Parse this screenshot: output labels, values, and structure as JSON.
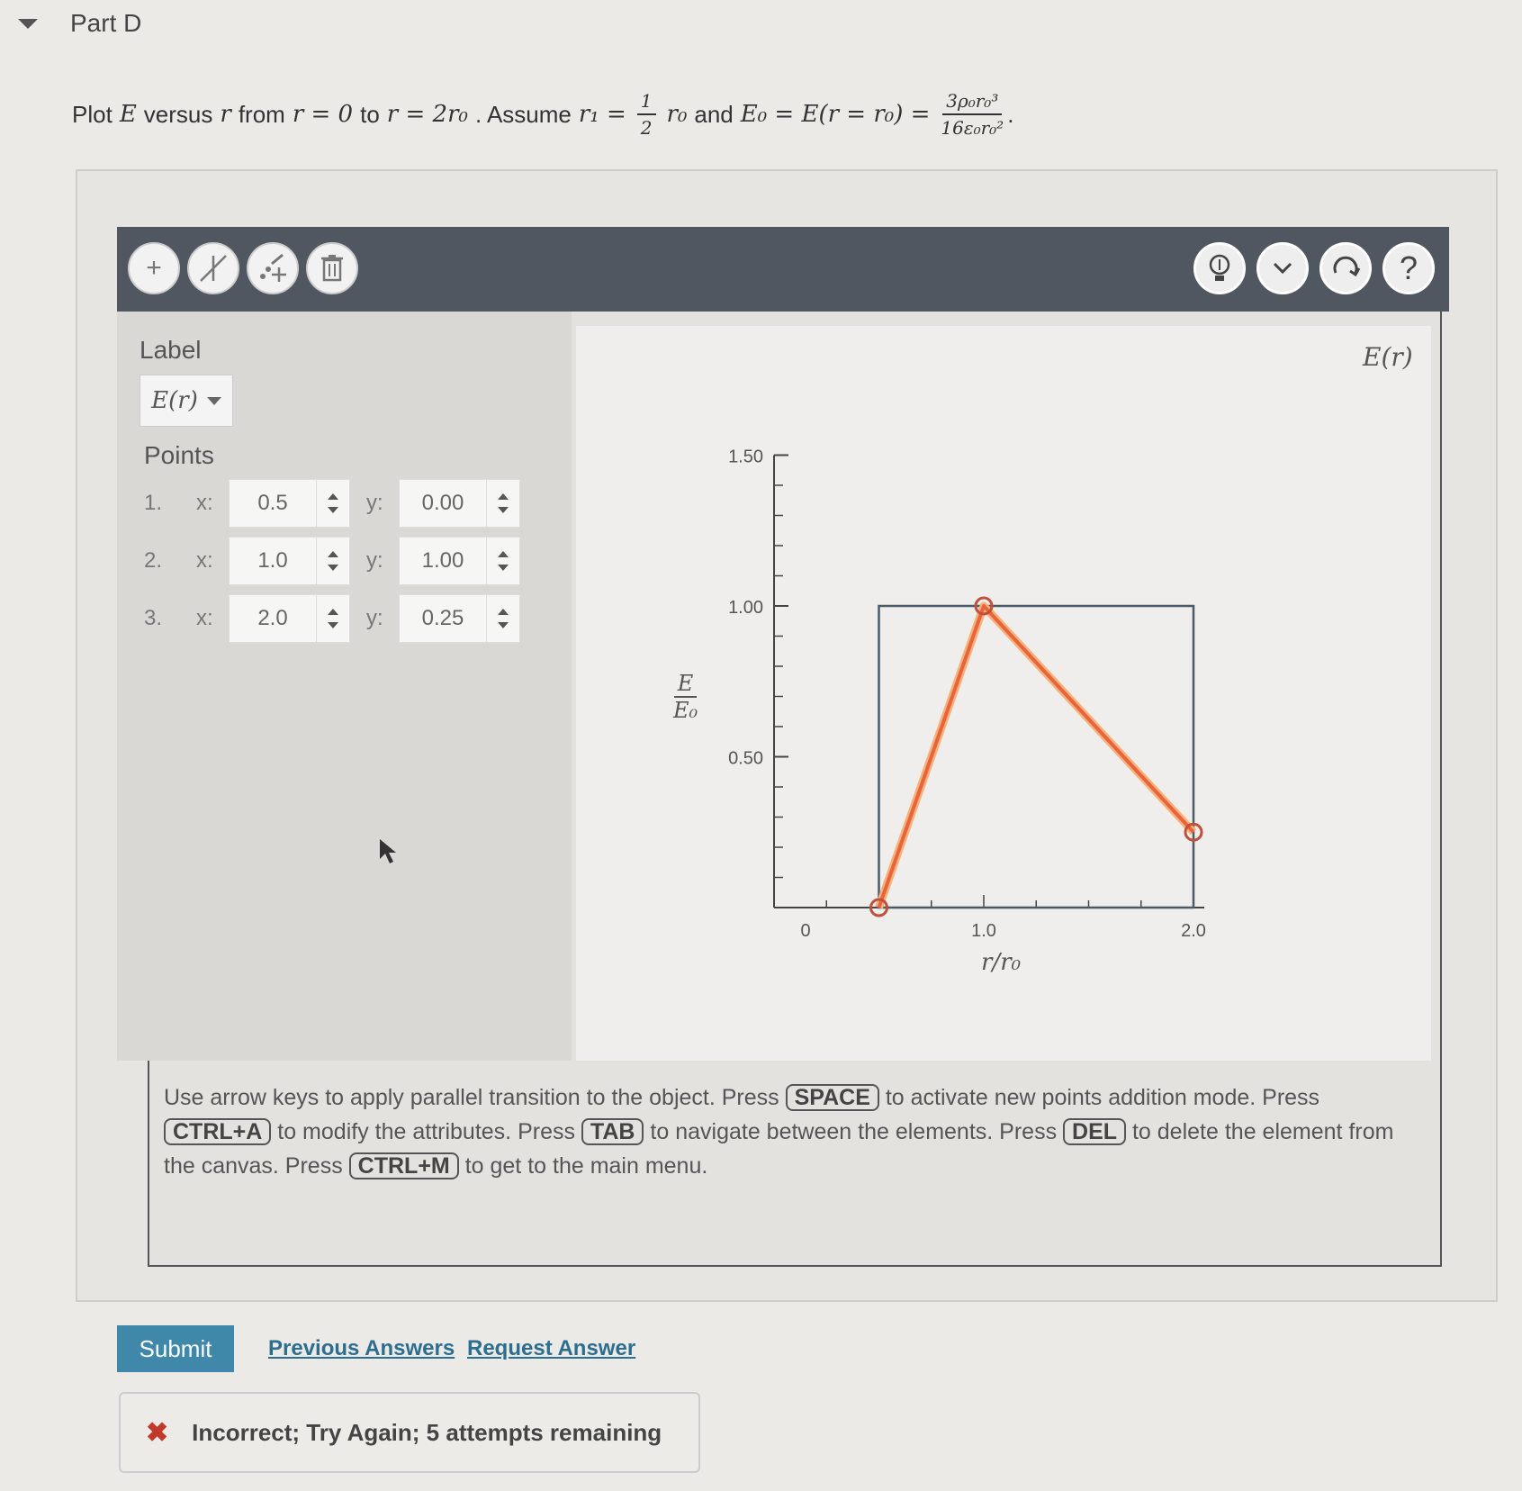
{
  "part": {
    "title": "Part D"
  },
  "question": {
    "t1": "Plot",
    "E": "E",
    "t2": "versus",
    "r": "r",
    "t3": "from",
    "eq1": "r = 0",
    "t4": "to",
    "eq2": "r = 2r₀",
    "t5": ". Assume",
    "eq3a": "r₁ =",
    "frac1_num": "1",
    "frac1_den": "2",
    "eq3b": "r₀",
    "t6": "and",
    "eq4": "E₀ = E(r = r₀) =",
    "frac2_num": "3ρ₀r₀³",
    "frac2_den": "16ε₀r₀²",
    "t7": "."
  },
  "toolbar": {
    "left_icons": [
      "add-point-icon",
      "add-line-icon",
      "edit-points-icon",
      "trash-icon"
    ],
    "right_icons": [
      "hint-bulb-icon",
      "chevron-down-icon",
      "reset-icon",
      "help-icon"
    ]
  },
  "panel": {
    "label_heading": "Label",
    "label_value": "E(r)",
    "points_heading": "Points",
    "points": [
      {
        "index": "1.",
        "x_label": "x:",
        "x": "0.5",
        "y_label": "y:",
        "y": "0.00"
      },
      {
        "index": "2.",
        "x_label": "x:",
        "x": "1.0",
        "y_label": "y:",
        "y": "1.00"
      },
      {
        "index": "3.",
        "x_label": "x:",
        "x": "2.0",
        "y_label": "y:",
        "y": "0.25"
      }
    ]
  },
  "graph": {
    "legend": "E(r)",
    "y_label_num": "E",
    "y_label_den": "E₀",
    "x_label": "r/r₀"
  },
  "chart_data": {
    "type": "line",
    "series": [
      {
        "name": "E(r)",
        "x": [
          0.5,
          1.0,
          2.0
        ],
        "y": [
          0.0,
          1.0,
          0.25
        ]
      }
    ],
    "y_ticks": [
      "1.50",
      "1.00",
      "0.50"
    ],
    "x_ticks": [
      "0",
      "1.0",
      "2.0"
    ],
    "xlim": [
      0,
      2.0
    ],
    "ylim": [
      0,
      1.5
    ],
    "line_color": "#e8643c",
    "marker_color": "#c0503a"
  },
  "instructions": {
    "p1": "Use arrow keys to apply parallel transition to the object. Press",
    "k1": "SPACE",
    "p2": "to activate new points addition mode. Press",
    "k2": "CTRL+A",
    "p3": "to modify the attributes. Press",
    "k3": "TAB",
    "p4": "to navigate between the elements. Press",
    "k4": "DEL",
    "p5": "to delete the element from the canvas. Press",
    "k5": "CTRL+M",
    "p6": "to get to the main menu."
  },
  "actions": {
    "submit": "Submit",
    "previous_answers": "Previous Answers",
    "request_answer": "Request Answer"
  },
  "feedback": {
    "icon": "✖",
    "text": "Incorrect; Try Again; 5 attempts remaining"
  }
}
